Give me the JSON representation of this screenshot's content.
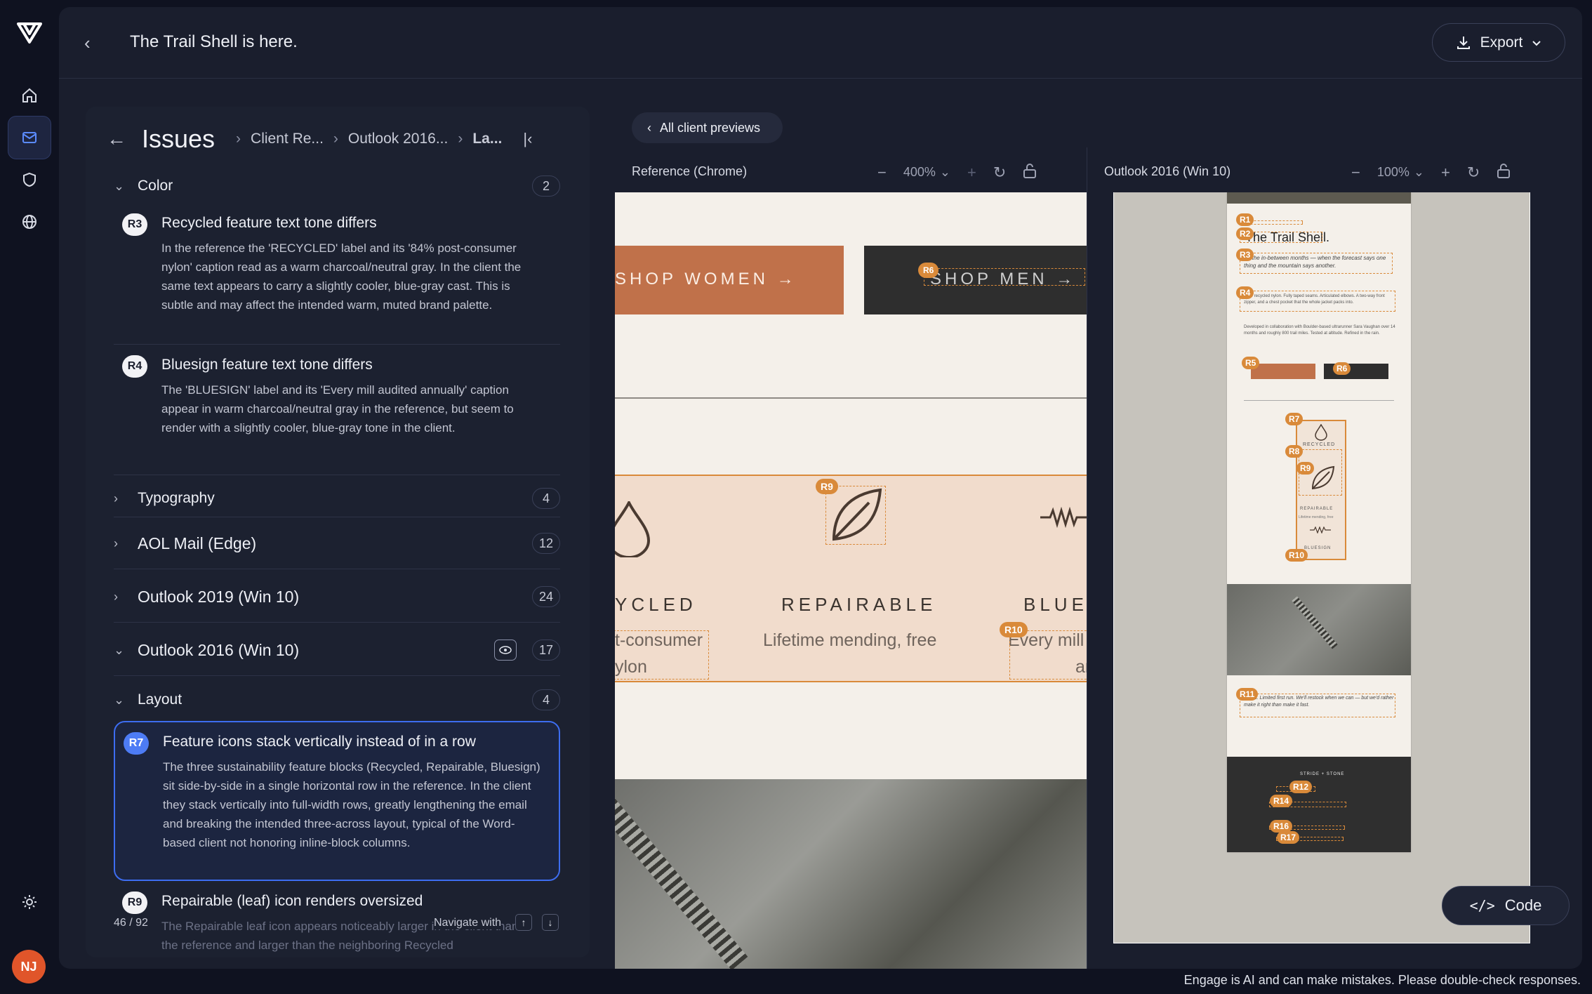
{
  "app": {
    "title": "The Trail Shell is here.",
    "export_label": "Export",
    "avatar": "NJ",
    "disclaimer": "Engage is AI and can make mistakes. Please double-check responses."
  },
  "breadcrumb": {
    "root": "Issues",
    "items": [
      "Client Re...",
      "Outlook 2016...",
      "La..."
    ]
  },
  "sections": {
    "color": {
      "label": "Color",
      "count": "2"
    },
    "typography": {
      "label": "Typography",
      "count": "4"
    },
    "aol": {
      "label": "AOL Mail (Edge)",
      "count": "12"
    },
    "outlook2019": {
      "label": "Outlook 2019 (Win 10)",
      "count": "24"
    },
    "outlook2016": {
      "label": "Outlook 2016 (Win 10)",
      "count": "17"
    },
    "layout": {
      "label": "Layout",
      "count": "4"
    }
  },
  "issues": [
    {
      "id": "R3",
      "title": "Recycled feature text tone differs",
      "desc": "In the reference the 'RECYCLED' label and its '84% post-consumer nylon' caption read as a warm charcoal/neutral gray. In the client the same text appears to carry a slightly cooler, blue-gray cast. This is subtle and may affect the intended warm, muted brand palette."
    },
    {
      "id": "R4",
      "title": "Bluesign feature text tone differs",
      "desc": "The 'BLUESIGN' label and its 'Every mill audited annually' caption appear in warm charcoal/neutral gray in the reference, but seem to render with a slightly cooler, blue-gray tone in the client."
    },
    {
      "id": "R7",
      "title": "Feature icons stack vertically instead of in a row",
      "desc": "The three sustainability feature blocks (Recycled, Repairable, Bluesign) sit side-by-side in a single horizontal row in the reference. In the client they stack vertically into full-width rows, greatly lengthening the email and breaking the intended three-across layout, typical of the Word-based client not honoring inline-block columns."
    },
    {
      "id": "R9",
      "title": "Repairable (leaf) icon renders oversized",
      "desc": "The Repairable leaf icon appears noticeably larger in the client than in the reference and larger than the neighboring Recycled"
    }
  ],
  "footer": {
    "position": "46 / 92",
    "navigate": "Navigate with"
  },
  "preview": {
    "all_label": "All client previews",
    "reference": {
      "label": "Reference (Chrome)",
      "zoom": "400%"
    },
    "client": {
      "label": "Outlook 2016 (Win 10)",
      "zoom": "100%"
    },
    "code_label": "Code"
  },
  "email": {
    "shop_women": "SHOP WOMEN →",
    "shop_men": "SHOP MEN →",
    "f1_label": "YCLED",
    "f1_caption_a": "t-consumer",
    "f1_caption_b": "ylon",
    "f2_label": "REPAIRABLE",
    "f2_caption": "Lifetime mending, free",
    "f3_label": "BLUES",
    "f3_caption_a": "Every mill",
    "f3_caption_b": "annu",
    "client_title": "The Trail Shell.",
    "client_p1": "for the in-between months — when the forecast says one thing and the mountain says another.",
    "client_p2": "layer recycled nylon. Fully taped seams. Articulated elbows. A two-way front zipper, and a chest pocket that the whole jacket packs into.",
    "client_p3": "Developed in collaboration with Boulder-based ultrarunner Sara Vaughan over 14 months and roughly 800 trail miles. Tested at altitude. Refined in the rain.",
    "client_recycled": "RECYCLED",
    "client_repairable": "REPAIRABLE",
    "client_mending": "Lifetime mending, free",
    "client_bluesign": "BLUESIGN",
    "client_p4": "colors. Limited first run. We'll restock when we can — but we'd rather make it right than make it fast.",
    "client_brand": "STRIDE + STONE"
  },
  "markers": {
    "ref": [
      "R6",
      "R9",
      "R10"
    ],
    "client": [
      "R1",
      "R2",
      "R3",
      "R4",
      "R5",
      "R6",
      "R7",
      "R8",
      "R9",
      "R10",
      "R11",
      "R12",
      "R14",
      "R16",
      "R17"
    ]
  }
}
